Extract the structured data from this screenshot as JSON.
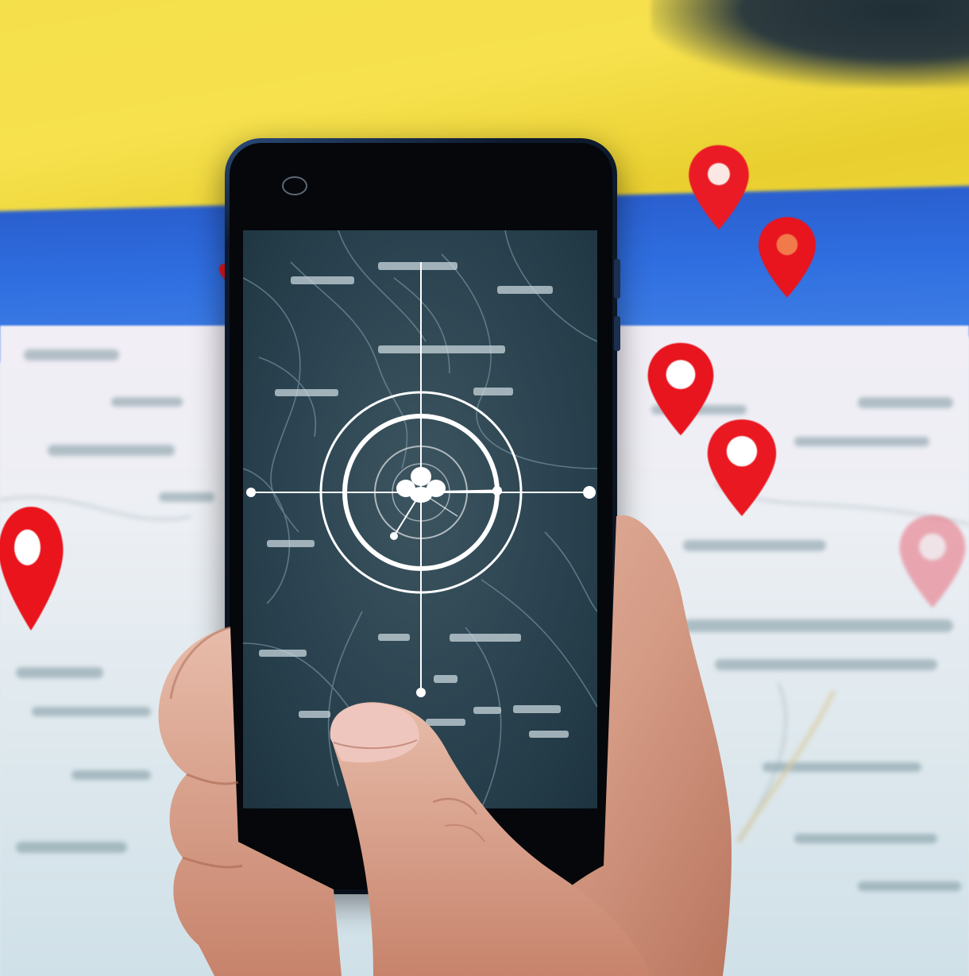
{
  "scene": {
    "description_free": true,
    "colors": {
      "flag_yellow": "#f4e04a",
      "flag_blue": "#2f6ee0",
      "map_background": "#e8eef3",
      "pin_red": "#e8161f",
      "phone_screen": "#2b4350",
      "reticle": "#ffffff",
      "skin": "#d9a48c"
    },
    "icons": [
      "location-pin-icon",
      "crosshair-icon",
      "camera-icon"
    ]
  }
}
